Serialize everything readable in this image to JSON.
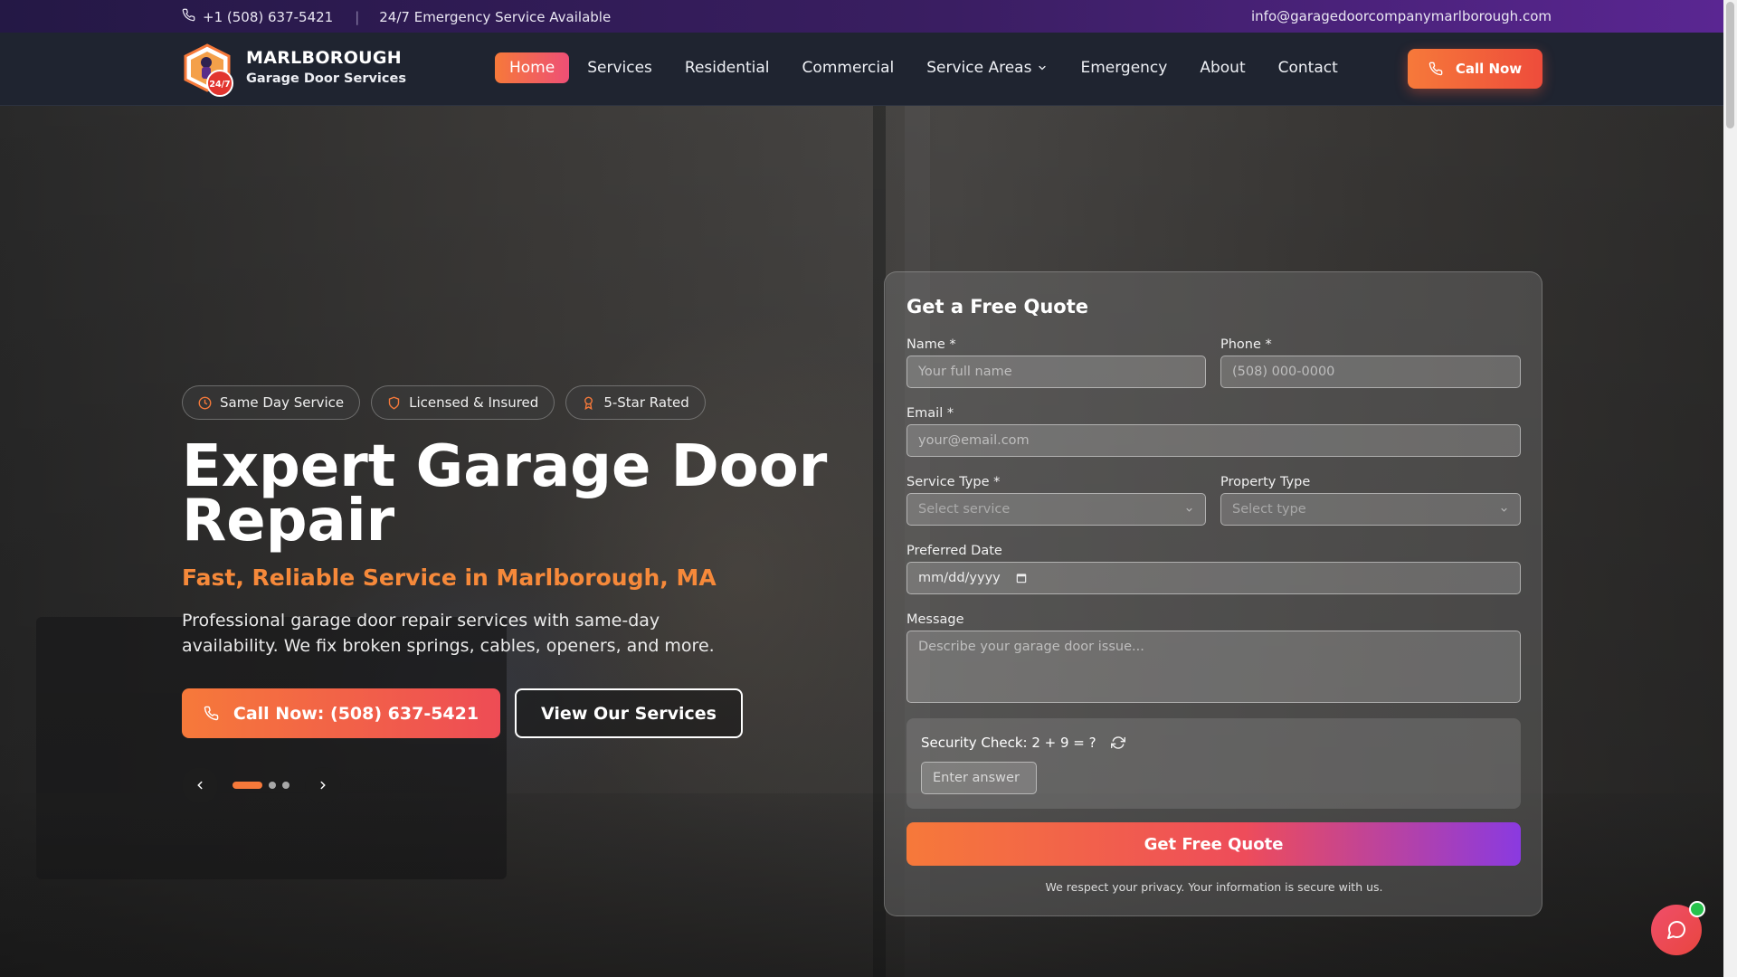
{
  "topbar": {
    "phone": "+1 (508) 637-5421",
    "separator": "|",
    "emergency": "24/7 Emergency Service Available",
    "email": "info@garagedoorcompanymarlborough.com"
  },
  "brand": {
    "name": "MARLBOROUGH",
    "tagline": "Garage Door Services",
    "logo_badge": "24/7"
  },
  "nav": {
    "items": [
      {
        "label": "Home",
        "active": true
      },
      {
        "label": "Services"
      },
      {
        "label": "Residential"
      },
      {
        "label": "Commercial"
      },
      {
        "label": "Service Areas",
        "dropdown": true
      },
      {
        "label": "Emergency"
      },
      {
        "label": "About"
      },
      {
        "label": "Contact"
      }
    ],
    "call_label": "Call Now"
  },
  "hero": {
    "badges": [
      {
        "label": "Same Day Service",
        "icon": "clock-icon"
      },
      {
        "label": "Licensed & Insured",
        "icon": "shield-icon"
      },
      {
        "label": "5-Star Rated",
        "icon": "award-icon"
      }
    ],
    "title": "Expert Garage Door Repair",
    "subtitle": "Fast, Reliable Service in Marlborough, MA",
    "description": "Professional garage door repair services with same-day availability. We fix broken springs, cables, openers, and more.",
    "primary_button": "Call Now: (508) 637-5421",
    "secondary_button": "View Our Services",
    "slides_total": 3,
    "slide_active": 1
  },
  "form": {
    "title": "Get a Free Quote",
    "name_label": "Name *",
    "name_placeholder": "Your full name",
    "phone_label": "Phone *",
    "phone_placeholder": "(508) 000-0000",
    "email_label": "Email *",
    "email_placeholder": "your@email.com",
    "service_label": "Service Type *",
    "service_placeholder": "Select service",
    "property_label": "Property Type",
    "property_placeholder": "Select type",
    "date_label": "Preferred Date",
    "date_placeholder": "mm/dd/yyyy",
    "message_label": "Message",
    "message_placeholder": "Describe your garage door issue...",
    "security_question": "Security Check: 2 + 9 = ?",
    "security_placeholder": "Enter answer",
    "submit_label": "Get Free Quote",
    "privacy_note": "We respect your privacy. Your information is secure with us."
  },
  "colors": {
    "accent_orange": "#f6793a",
    "accent_pink": "#ee4c55",
    "accent_purple": "#8a3ae0",
    "nav_bg": "#1f2430",
    "online_green": "#27c24c"
  }
}
